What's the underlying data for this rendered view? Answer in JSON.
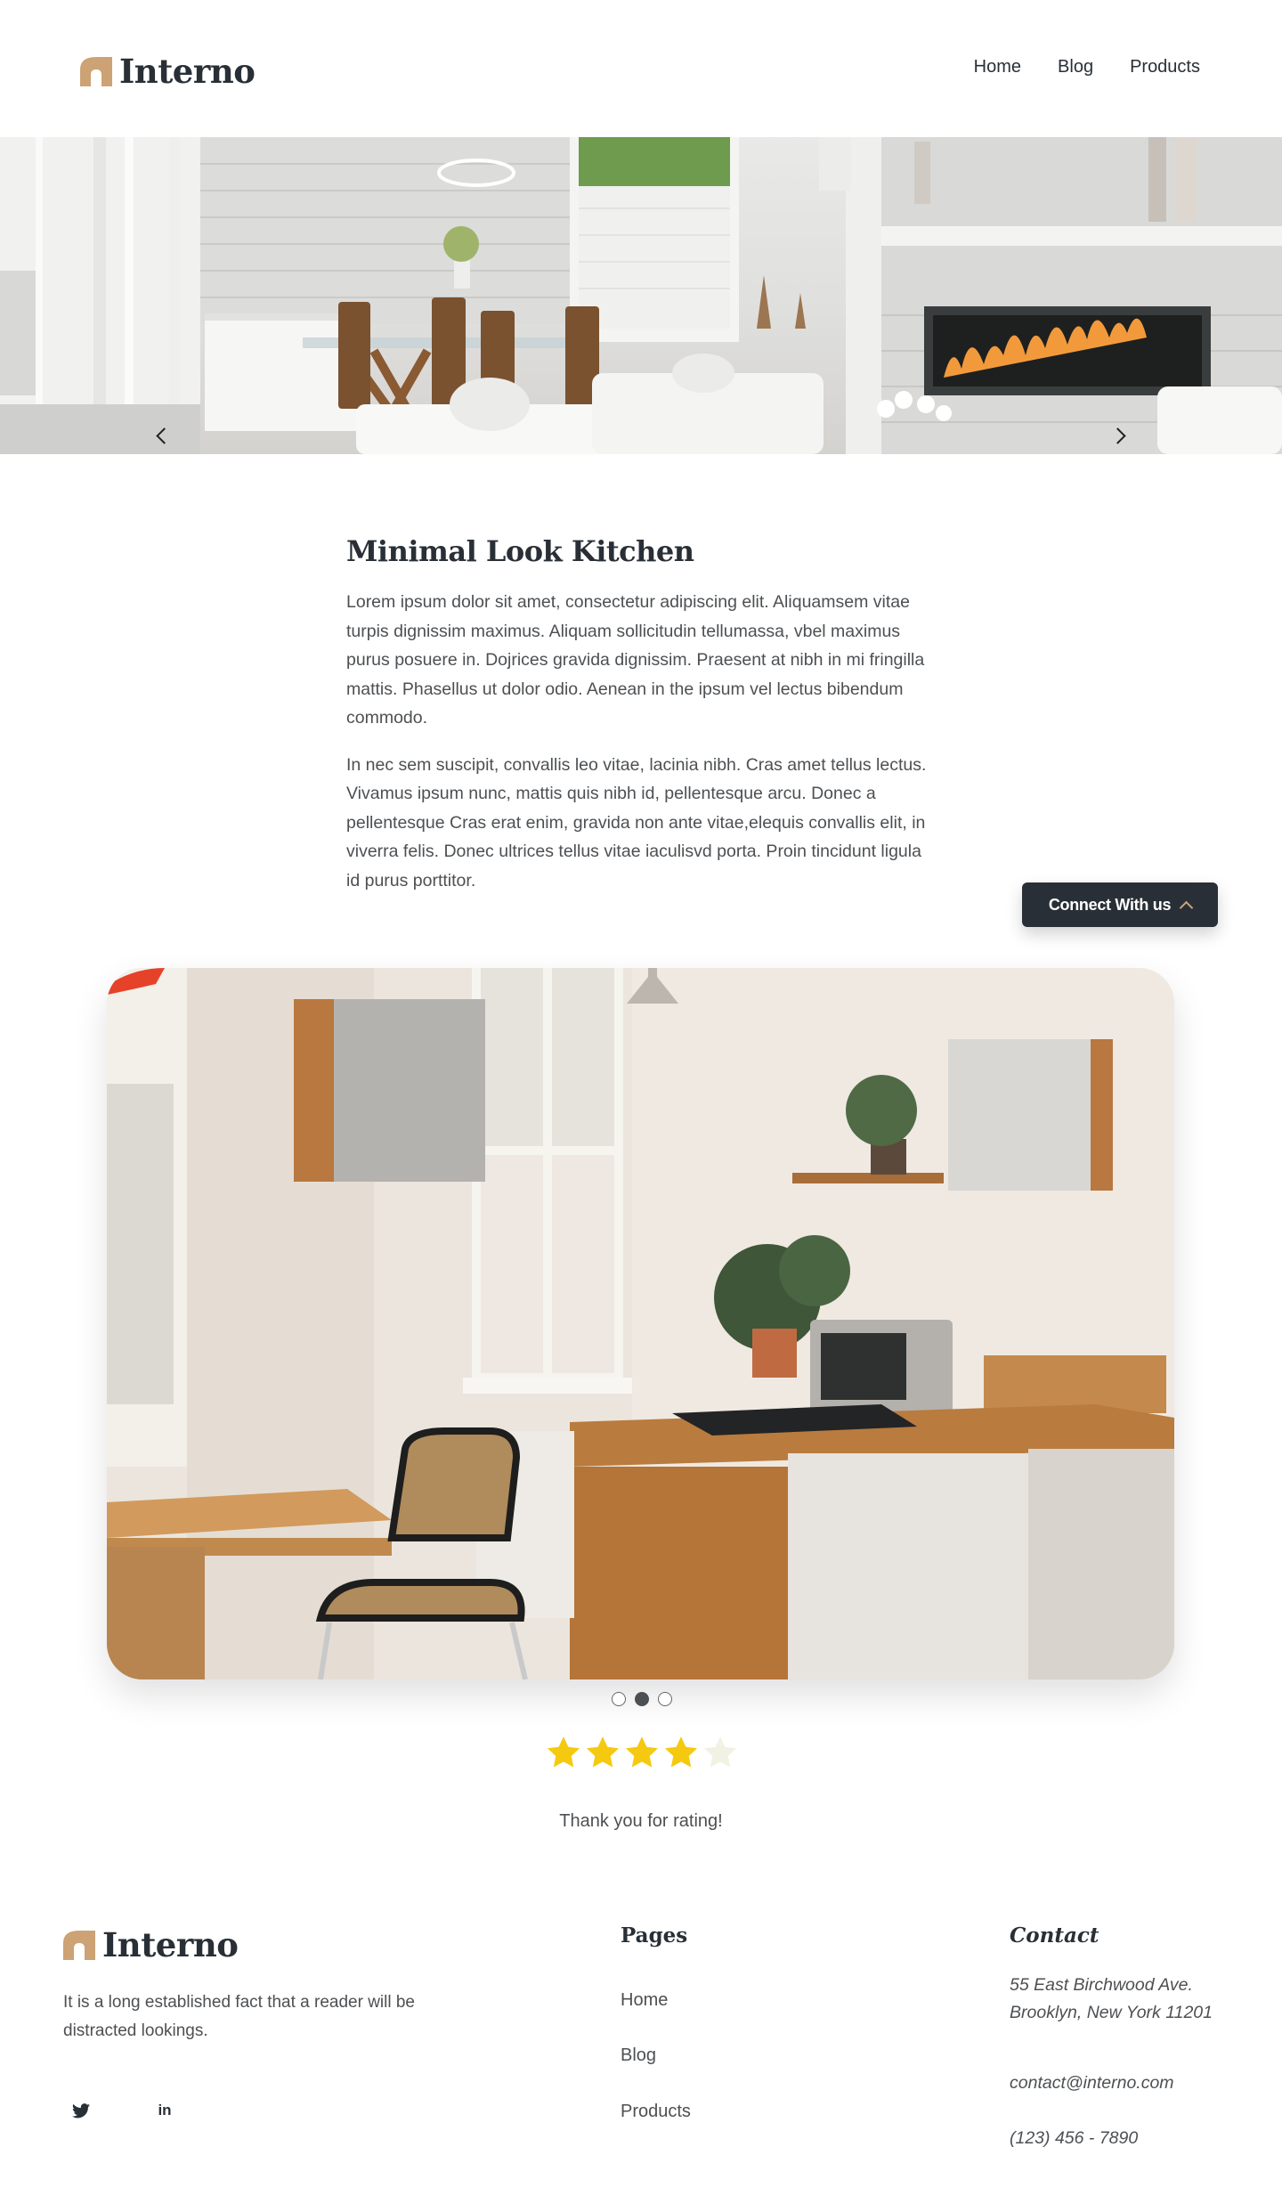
{
  "brand": {
    "name": "Interno",
    "accent": "#cda274",
    "dark": "#292f36"
  },
  "nav": {
    "items": [
      "Home",
      "Blog",
      "Products"
    ]
  },
  "article": {
    "title": "Minimal Look Kitchen",
    "paragraphs": [
      "Lorem ipsum dolor sit amet, consectetur adipiscing elit. Aliquamsem vitae turpis dignissim maximus. Aliquam sollicitudin tellumassa, vbel maximus purus posuere in. Dojrices gravida dignissim. Praesent at nibh in mi fringilla mattis. Phasellus ut dolor odio. Aenean in the ipsum vel lectus bibendum commodo.",
      "In nec sem suscipit, convallis leo vitae, lacinia nibh. Cras amet tellus lectus. Vivamus ipsum nunc, mattis quis nibh id, pellentesque arcu. Donec a pellentesque Cras erat enim, gravida non ante vitae,elequis convallis elit, in viverra felis. Donec ultrices tellus vitae iaculisvd porta. Proin tincidunt ligula id purus porttitor."
    ]
  },
  "connect_button": {
    "label": "Connect With us",
    "icon": "chevron-up-icon"
  },
  "carousel": {
    "slide_count": 3,
    "active_index": 1
  },
  "rating": {
    "value": 4,
    "max": 5,
    "message": "Thank you for rating!",
    "star_color": "#f5c90f",
    "empty_star_color": "#f2f2e4"
  },
  "footer": {
    "description": "It is a long established fact that a reader will be distracted lookings.",
    "social": [
      "twitter-icon",
      "linkedin-icon"
    ],
    "pages_title": "Pages",
    "pages": [
      "Home",
      "Blog",
      "Products"
    ],
    "contact_title": "Contact",
    "address": "55 East Birchwood Ave. Brooklyn, New York 11201",
    "email": "contact@interno.com",
    "phone": "(123) 456 - 7890"
  }
}
